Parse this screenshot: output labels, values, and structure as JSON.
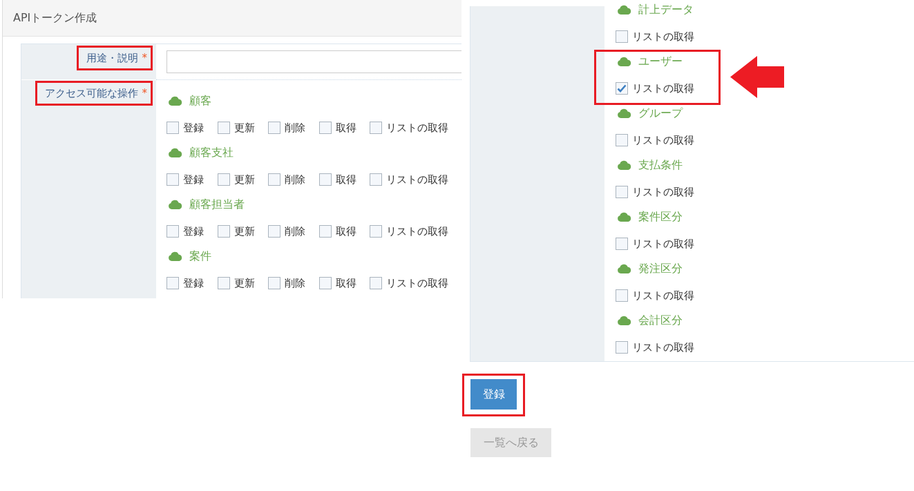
{
  "creation_panel": {
    "title": "APIトークン作成",
    "fields": [
      {
        "kind": "text_input",
        "label": "用途・説明",
        "required_mark": "*",
        "highlighted": true
      },
      {
        "kind": "operations",
        "label": "アクセス可能な操作",
        "required_mark": "*",
        "highlighted": true,
        "groups": [
          {
            "name": "顧客",
            "highlighted": false,
            "options": [
              {
                "label": "登録",
                "checked": false
              },
              {
                "label": "更新",
                "checked": false
              },
              {
                "label": "削除",
                "checked": false
              },
              {
                "label": "取得",
                "checked": false
              },
              {
                "label": "リストの取得",
                "checked": false
              }
            ]
          },
          {
            "name": "顧客支社",
            "highlighted": false,
            "options": [
              {
                "label": "登録",
                "checked": false
              },
              {
                "label": "更新",
                "checked": false
              },
              {
                "label": "削除",
                "checked": false
              },
              {
                "label": "取得",
                "checked": false
              },
              {
                "label": "リストの取得",
                "checked": false
              }
            ]
          },
          {
            "name": "顧客担当者",
            "highlighted": false,
            "options": [
              {
                "label": "登録",
                "checked": false
              },
              {
                "label": "更新",
                "checked": false
              },
              {
                "label": "削除",
                "checked": false
              },
              {
                "label": "取得",
                "checked": false
              },
              {
                "label": "リストの取得",
                "checked": false
              }
            ]
          },
          {
            "name": "案件",
            "highlighted": false,
            "options": [
              {
                "label": "登録",
                "checked": false
              },
              {
                "label": "更新",
                "checked": false
              },
              {
                "label": "削除",
                "checked": false
              },
              {
                "label": "取得",
                "checked": false
              },
              {
                "label": "リストの取得",
                "checked": false
              }
            ]
          }
        ]
      }
    ]
  },
  "continued_panel": {
    "groups": [
      {
        "name": "計上データ",
        "highlighted": false,
        "options": [
          {
            "label": "リストの取得",
            "checked": false
          }
        ]
      },
      {
        "name": "ユーザー",
        "highlighted": true,
        "options": [
          {
            "label": "リストの取得",
            "checked": true
          }
        ]
      },
      {
        "name": "グループ",
        "highlighted": false,
        "options": [
          {
            "label": "リストの取得",
            "checked": false
          }
        ]
      },
      {
        "name": "支払条件",
        "highlighted": false,
        "options": [
          {
            "label": "リストの取得",
            "checked": false
          }
        ]
      },
      {
        "name": "案件区分",
        "highlighted": false,
        "options": [
          {
            "label": "リストの取得",
            "checked": false
          }
        ]
      },
      {
        "name": "発注区分",
        "highlighted": false,
        "options": [
          {
            "label": "リストの取得",
            "checked": false
          }
        ]
      },
      {
        "name": "会計区分",
        "highlighted": false,
        "options": [
          {
            "label": "リストの取得",
            "checked": false
          }
        ]
      }
    ]
  },
  "buttons": [
    {
      "label": "登録",
      "kind": "primary",
      "highlighted": true
    },
    {
      "label": "一覧へ戻る",
      "kind": "secondary",
      "highlighted": false
    }
  ]
}
